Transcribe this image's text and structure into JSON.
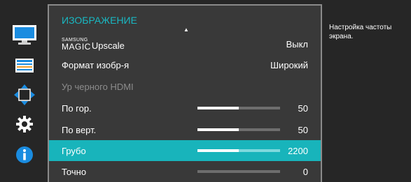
{
  "menu": {
    "title": "ИЗОБРАЖЕНИЕ",
    "scroll_up_icon": "triangle-up-icon",
    "items": [
      {
        "brand_top": "SAMSUNG",
        "brand_main": "MAGIC",
        "label": "Upscale",
        "value": "Выкл"
      },
      {
        "label": "Формат изобр-я",
        "value": "Широкий"
      },
      {
        "label": "Ур черного HDMI",
        "value": "",
        "disabled": true
      },
      {
        "label": "По гор.",
        "value": "50",
        "level_percent": 50
      },
      {
        "label": "По верт.",
        "value": "50",
        "level_percent": 50
      },
      {
        "label": "Грубо",
        "value": "2200",
        "level_percent": 50,
        "selected": true
      },
      {
        "label": "Точно",
        "value": "0",
        "level_percent": 0
      }
    ]
  },
  "sidebar": {
    "icons": [
      "monitor-icon",
      "settings-list-icon",
      "arrows-move-icon",
      "gear-icon",
      "info-icon"
    ],
    "active": "monitor-icon"
  },
  "help": {
    "text": "Настройка частоты экрана."
  },
  "colors": {
    "accent": "#18b4bb",
    "title": "#19b8c2",
    "panel": "#393939",
    "background": "#262626",
    "icon_blue": "#1a8ce0"
  }
}
